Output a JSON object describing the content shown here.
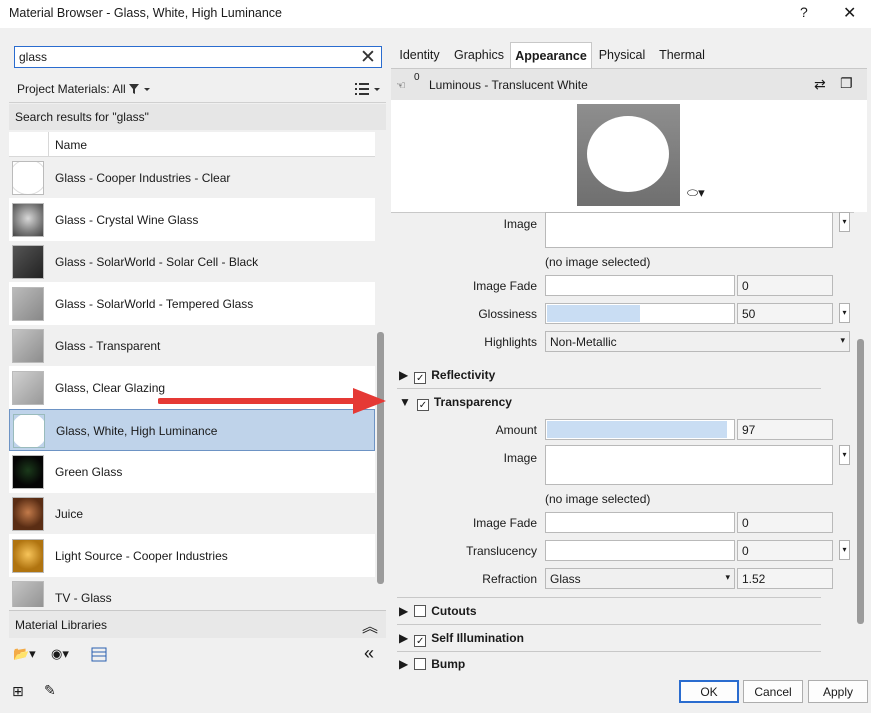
{
  "window": {
    "title": "Material Browser - Glass, White, High Luminance",
    "help": "?",
    "close": "✕"
  },
  "search": {
    "value": "glass"
  },
  "filter": {
    "label": "Project Materials: All"
  },
  "results": {
    "label": "Search results for \"glass\""
  },
  "list": {
    "column_header": "Name",
    "items": [
      {
        "name": "Glass - Cooper Industries - Clear"
      },
      {
        "name": "Glass - Crystal Wine Glass"
      },
      {
        "name": "Glass - SolarWorld - Solar Cell - Black"
      },
      {
        "name": "Glass - SolarWorld - Tempered Glass"
      },
      {
        "name": "Glass - Transparent"
      },
      {
        "name": "Glass, Clear Glazing"
      },
      {
        "name": "Glass, White, High Luminance"
      },
      {
        "name": "Green Glass"
      },
      {
        "name": "Juice"
      },
      {
        "name": "Light Source - Cooper Industries"
      },
      {
        "name": "TV - Glass"
      }
    ]
  },
  "libraries": {
    "label": "Material Libraries"
  },
  "tabs": [
    "Identity",
    "Graphics",
    "Appearance",
    "Physical",
    "Thermal"
  ],
  "asset": {
    "count": "0",
    "name": "Luminous - Translucent White"
  },
  "props": {
    "image_label": "Image",
    "no_image": "(no image selected)",
    "image_fade_label": "Image Fade",
    "image_fade_value": "0",
    "glossiness_label": "Glossiness",
    "glossiness_value": "50",
    "highlights_label": "Highlights",
    "highlights_value": "Non-Metallic",
    "reflectivity": "Reflectivity",
    "transparency": "Transparency",
    "amount_label": "Amount",
    "amount_value": "97",
    "t_image_label": "Image",
    "t_no_image": "(no image selected)",
    "t_image_fade_label": "Image Fade",
    "t_image_fade_value": "0",
    "translucency_label": "Translucency",
    "translucency_value": "0",
    "refraction_label": "Refraction",
    "refraction_select": "Glass",
    "refraction_value": "1.52",
    "cutouts": "Cutouts",
    "self_illumination": "Self Illumination",
    "bump": "Bump"
  },
  "buttons": {
    "ok": "OK",
    "cancel": "Cancel",
    "apply": "Apply"
  },
  "colors": {
    "accent": "#2a6ccf",
    "selection": "#bfd3ea",
    "arrow": "#e53935"
  }
}
